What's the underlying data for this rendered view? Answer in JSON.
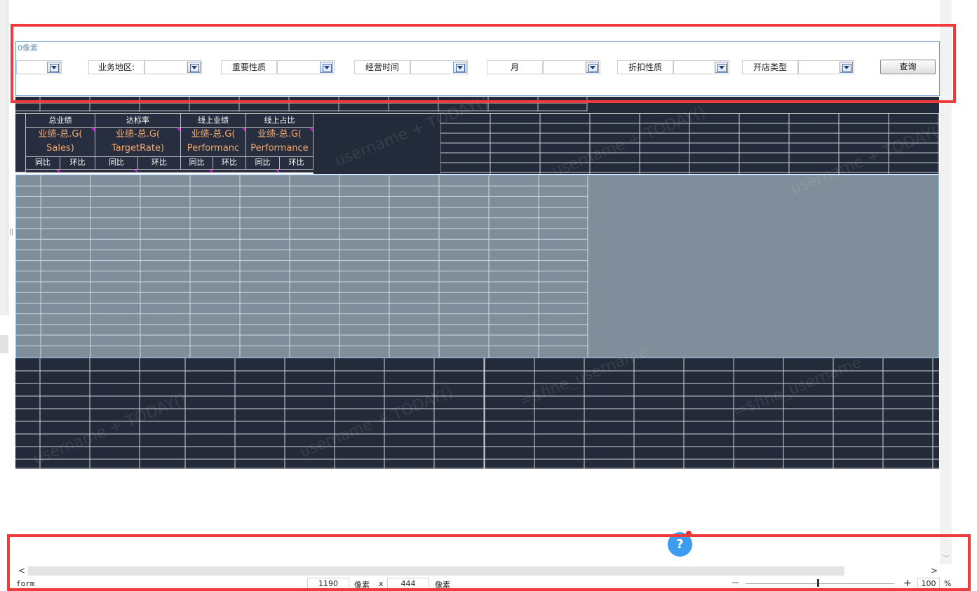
{
  "param_panel": {
    "caption": "0像素",
    "labels": [
      "业务地区:",
      "重要性质",
      "经营时间",
      "月",
      "折扣性质",
      "开店类型"
    ],
    "query_label": "查询"
  },
  "kpi": {
    "headers": [
      "总业绩",
      "达标率",
      "线上业绩",
      "线上占比"
    ],
    "formulas": [
      [
        "业绩-总.G(",
        "Sales)"
      ],
      [
        "业绩-总.G(",
        "TargetRate)"
      ],
      [
        "业绩-总.G(",
        "Performanc"
      ],
      [
        "业绩-总.G(",
        "Performance"
      ]
    ],
    "sub_headers": [
      "同比",
      "环比",
      "同比",
      "环比",
      "同比",
      "环比",
      "同比",
      "环比"
    ]
  },
  "watermark": {
    "text_a": "username + TODAY()",
    "text_b": "=$fine_username"
  },
  "help": {
    "symbol": "?"
  },
  "scrollbar": {
    "left": "<",
    "right": ">",
    "down": "﹀"
  },
  "status": {
    "mode": "form",
    "width": "1190",
    "unit1": "像素",
    "times": "x",
    "height": "444",
    "unit2": "像素",
    "zoom_minus": "—",
    "zoom_plus": "+",
    "zoom_value": "100",
    "zoom_unit": "%"
  }
}
